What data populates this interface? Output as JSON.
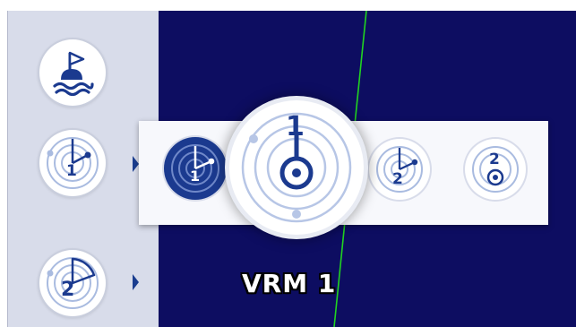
{
  "colors": {
    "sea": "#0d0d61",
    "panel": "#d8dcea",
    "accent": "#1b3a8f",
    "heading_line": "#21d321"
  },
  "sidebar": {
    "items": [
      {
        "icon": "buoy-icon"
      },
      {
        "icon": "vrm-1-icon",
        "digit": "1"
      },
      {
        "icon": "vrm-2-icon",
        "digit": "2"
      }
    ]
  },
  "flyout": {
    "options": [
      {
        "icon": "vrm-1-ebl-icon",
        "digit": "1",
        "selected": true
      },
      {
        "icon": "vrm-1-icon",
        "digit": "1",
        "selected": false
      },
      {
        "icon": "vrm-2-ebl-icon",
        "digit": "2",
        "selected": false
      },
      {
        "icon": "vrm-2-icon",
        "digit": "2",
        "selected": false
      }
    ]
  },
  "tooltip": {
    "label": "VRM 1"
  }
}
